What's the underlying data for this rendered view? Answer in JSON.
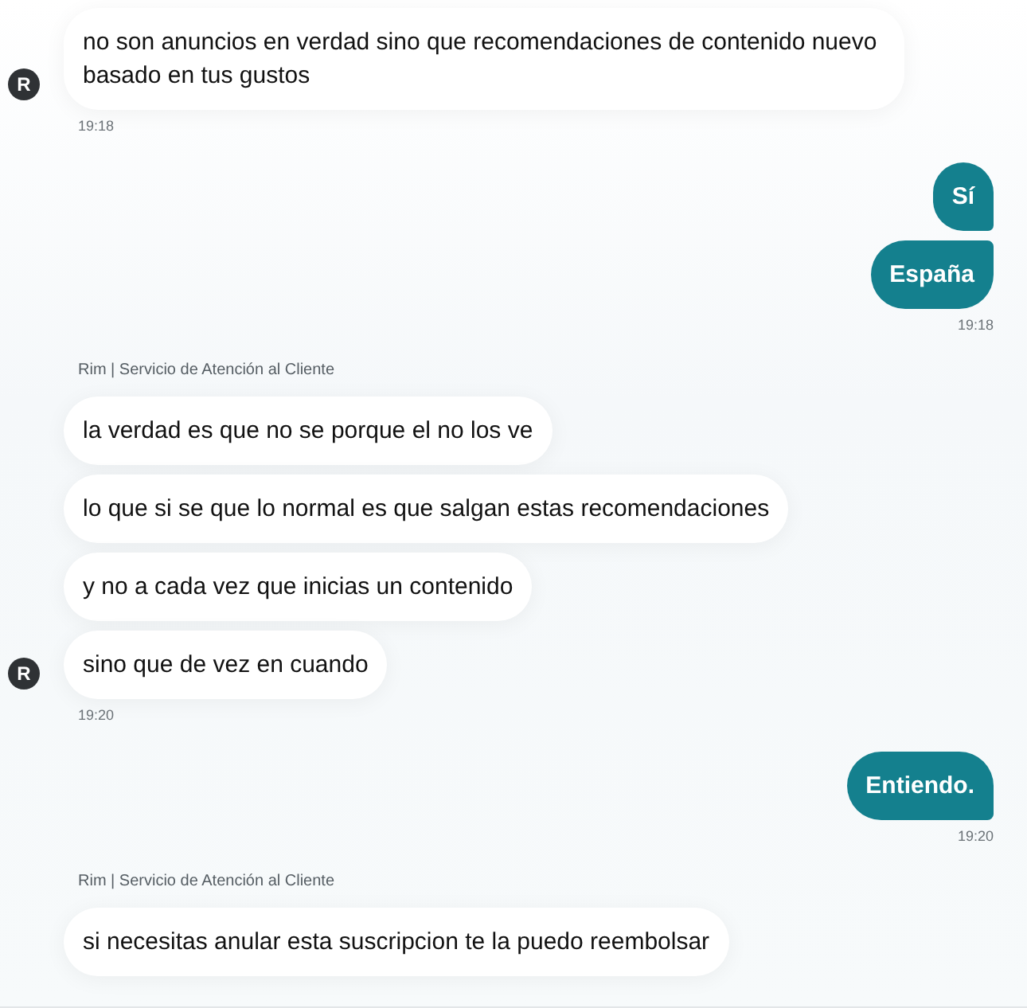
{
  "groups": [
    {
      "kind": "agent",
      "avatar": "R",
      "messages": [
        {
          "text": "no son anuncios en verdad sino que recomendaciones de contenido nuevo basado en tus gustos"
        }
      ],
      "time": "19:18"
    },
    {
      "kind": "user",
      "messages": [
        {
          "text": "Sí"
        },
        {
          "text": "España"
        }
      ],
      "time": "19:18"
    },
    {
      "kind": "agent",
      "name": "Rim | Servicio de Atención al Cliente",
      "avatar": "R",
      "messages": [
        {
          "text": "la verdad es que no se porque el no los ve"
        },
        {
          "text": "lo que si se que lo normal es que salgan estas recomendaciones"
        },
        {
          "text": "y no a cada vez que inicias un contenido"
        },
        {
          "text": "sino que de vez en cuando"
        }
      ],
      "time": "19:20"
    },
    {
      "kind": "user",
      "messages": [
        {
          "text": "Entiendo."
        }
      ],
      "time": "19:20"
    },
    {
      "kind": "agent",
      "name": "Rim | Servicio de Atención al Cliente",
      "messages": [
        {
          "text": "si necesitas anular esta suscripcion te la puedo reembolsar"
        }
      ]
    }
  ]
}
